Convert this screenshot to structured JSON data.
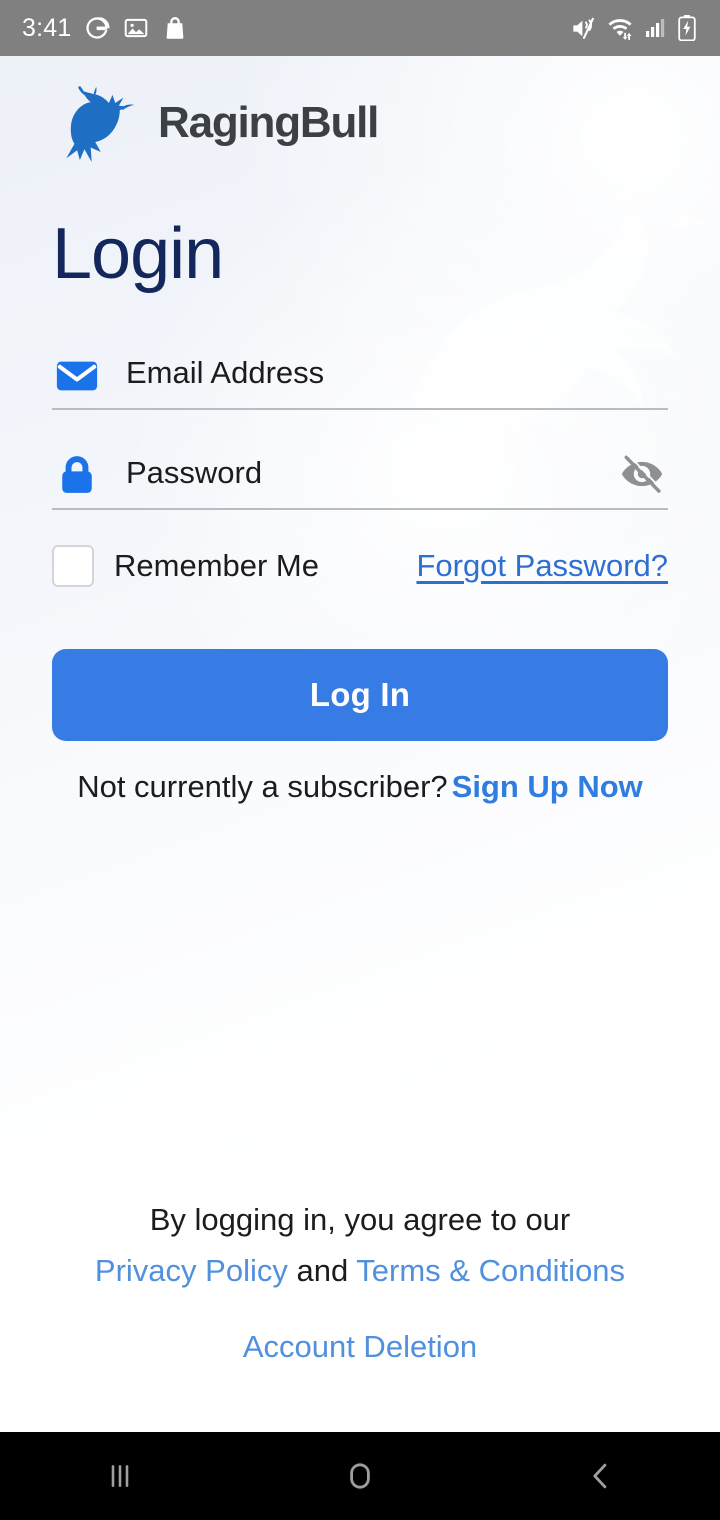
{
  "status_bar": {
    "time": "3:41",
    "left_icons": [
      "google-g-icon",
      "photos-icon",
      "shopping-bag-icon"
    ],
    "right_icons": [
      "mute-vibrate-icon",
      "wifi-data-icon",
      "cellular-signal-icon",
      "battery-charging-icon"
    ],
    "background_color": "#808080"
  },
  "brand": {
    "logo_icon": "raging-bull-logo",
    "name": "RagingBull",
    "logo_color": "#1e6fc4",
    "word_color": "#3c4043"
  },
  "page": {
    "title": "Login",
    "title_color": "#14275c",
    "accent_color": "#377ce4",
    "link_color": "#2f6fd0",
    "footer_link_color": "#5090de"
  },
  "form": {
    "email": {
      "icon": "email-envelope-icon",
      "placeholder": "Email Address",
      "value": ""
    },
    "password": {
      "icon": "lock-icon",
      "placeholder": "Password",
      "value": "",
      "toggle_icon": "eye-off-icon"
    },
    "remember": {
      "label": "Remember Me",
      "checked": false
    },
    "forgot_password": "Forgot Password?",
    "submit_label": "Log In"
  },
  "subscriber": {
    "prompt": "Not currently a subscriber?",
    "cta": "Sign Up Now"
  },
  "footer": {
    "agreement": "By logging in, you agree to our",
    "privacy_policy": "Privacy Policy",
    "conjunction": "and",
    "terms": "Terms & Conditions",
    "account_deletion": "Account Deletion"
  },
  "nav_bar": {
    "recents": "recents-icon",
    "home": "home-icon",
    "back": "back-icon",
    "background_color": "#000000",
    "icon_color": "#9e9e9e"
  }
}
